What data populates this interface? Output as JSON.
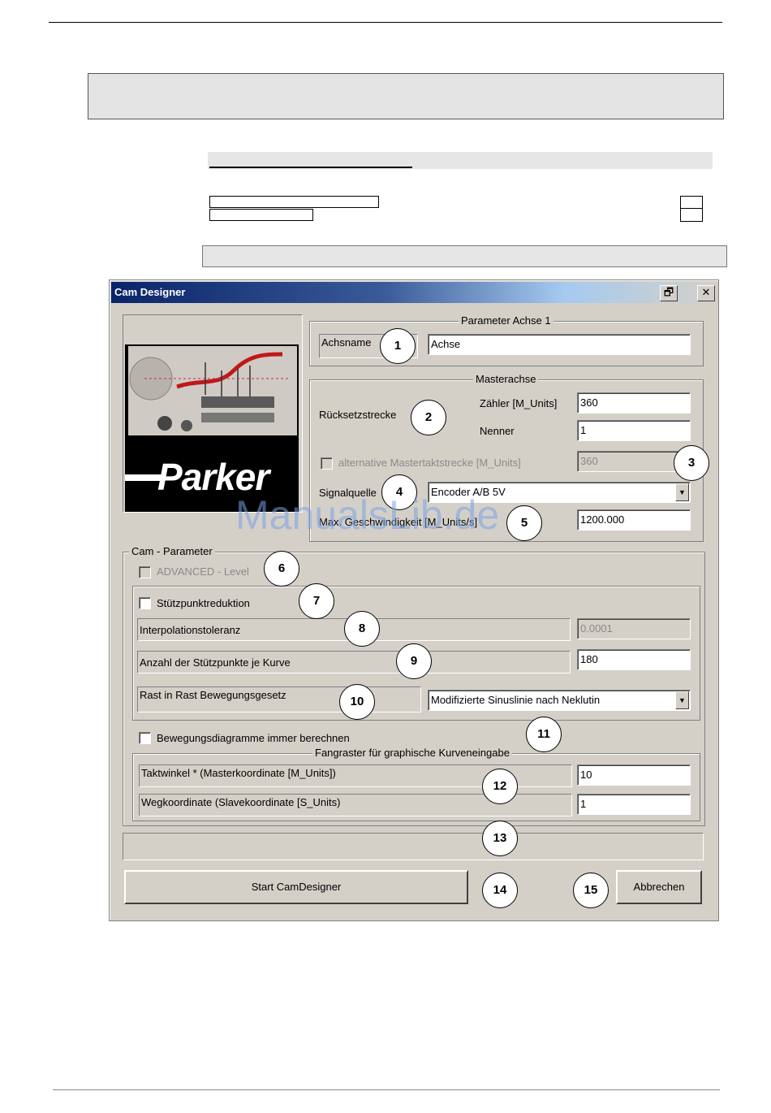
{
  "window": {
    "title": "Cam Designer",
    "restore_glyph": "🗗",
    "close_glyph": "✕"
  },
  "logo": {
    "brand": "Parker"
  },
  "params_axis": {
    "group_label": "Parameter Achse 1",
    "axis_name_label": "Achsname",
    "axis_name_value": "Achse"
  },
  "master_axis": {
    "group_label": "Masterachse",
    "reset_label": "Rücksetzstrecke",
    "numerator_label": "Zähler [M_Units]",
    "numerator_value": "360",
    "denominator_label": "Nenner",
    "denominator_value": "1",
    "alt_checkbox_label": "alternative Mastertaktstrecke [M_Units]",
    "alt_value": "360",
    "signal_label": "Signalquelle",
    "signal_value": "Encoder A/B 5V",
    "speed_label": "Max. Geschwindigkeit [M_Units/s]",
    "speed_value": "1200.000"
  },
  "cam_params": {
    "group_label": "Cam - Parameter",
    "advanced_label": "ADVANCED - Level",
    "reduction_label": "Stützpunktreduktion",
    "interp_label": "Interpolationstoleranz",
    "interp_value": "0.0001",
    "points_label": "Anzahl der Stützpunkte je Kurve",
    "points_value": "180",
    "motion_law_label": "Rast in Rast Bewegungsgesetz",
    "motion_law_value": "Modifizierte Sinuslinie nach Neklutin",
    "always_calc_label": "Bewegungsdiagramme immer berechnen",
    "snap_group_label": "Fangraster für graphische Kurveneingabe",
    "cycle_angle_label": "Taktwinkel * (Masterkoordinate [M_Units])",
    "cycle_angle_value": "10",
    "path_coord_label": "Wegkoordinate (Slavekoordinate [S_Units)",
    "path_coord_value": "1"
  },
  "buttons": {
    "start": "Start CamDesigner",
    "cancel": "Abbrechen"
  },
  "callouts": [
    "1",
    "2",
    "3",
    "4",
    "5",
    "6",
    "7",
    "8",
    "9",
    "10",
    "11",
    "12",
    "13",
    "14",
    "15"
  ],
  "watermark": "ManualsLib.de"
}
